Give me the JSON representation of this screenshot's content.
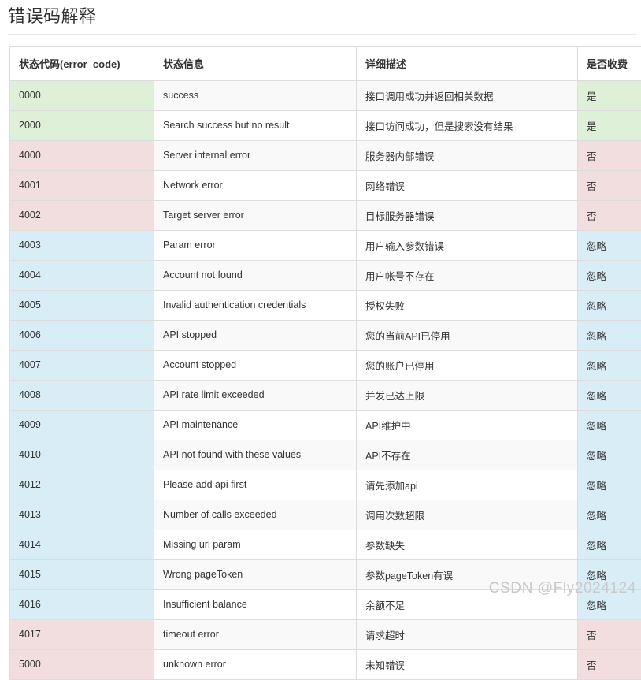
{
  "page": {
    "title": "错误码解释",
    "watermark": "CSDN @Fly2024124"
  },
  "table": {
    "columns": [
      {
        "key": "error_code",
        "label": "状态代码(error_code)"
      },
      {
        "key": "status_message",
        "label": "状态信息"
      },
      {
        "key": "description",
        "label": "详细描述"
      },
      {
        "key": "billable",
        "label": "是否收费"
      }
    ],
    "rows": [
      {
        "error_code": "0000",
        "status_message": "success",
        "description": "接口调用成功并返回相关数据",
        "billable": "是",
        "tint": "green"
      },
      {
        "error_code": "2000",
        "status_message": "Search success but no result",
        "description": "接口访问成功，但是搜索没有结果",
        "billable": "是",
        "tint": "green"
      },
      {
        "error_code": "4000",
        "status_message": "Server internal error",
        "description": "服务器内部错误",
        "billable": "否",
        "tint": "red"
      },
      {
        "error_code": "4001",
        "status_message": "Network error",
        "description": "网络错误",
        "billable": "否",
        "tint": "red"
      },
      {
        "error_code": "4002",
        "status_message": "Target server error",
        "description": "目标服务器错误",
        "billable": "否",
        "tint": "red"
      },
      {
        "error_code": "4003",
        "status_message": "Param error",
        "description": "用户输入参数错误",
        "billable": "忽略",
        "tint": "blue"
      },
      {
        "error_code": "4004",
        "status_message": "Account not found",
        "description": "用户帐号不存在",
        "billable": "忽略",
        "tint": "blue"
      },
      {
        "error_code": "4005",
        "status_message": "Invalid authentication credentials",
        "description": "授权失败",
        "billable": "忽略",
        "tint": "blue"
      },
      {
        "error_code": "4006",
        "status_message": "API stopped",
        "description": "您的当前API已停用",
        "billable": "忽略",
        "tint": "blue"
      },
      {
        "error_code": "4007",
        "status_message": "Account stopped",
        "description": "您的账户已停用",
        "billable": "忽略",
        "tint": "blue"
      },
      {
        "error_code": "4008",
        "status_message": "API rate limit exceeded",
        "description": "并发已达上限",
        "billable": "忽略",
        "tint": "blue"
      },
      {
        "error_code": "4009",
        "status_message": "API maintenance",
        "description": "API维护中",
        "billable": "忽略",
        "tint": "blue"
      },
      {
        "error_code": "4010",
        "status_message": "API not found with these values",
        "description": "API不存在",
        "billable": "忽略",
        "tint": "blue"
      },
      {
        "error_code": "4012",
        "status_message": "Please add api first",
        "description": "请先添加api",
        "billable": "忽略",
        "tint": "blue"
      },
      {
        "error_code": "4013",
        "status_message": "Number of calls exceeded",
        "description": "调用次数超限",
        "billable": "忽略",
        "tint": "blue"
      },
      {
        "error_code": "4014",
        "status_message": "Missing url param",
        "description": "参数缺失",
        "billable": "忽略",
        "tint": "blue"
      },
      {
        "error_code": "4015",
        "status_message": "Wrong pageToken",
        "description": "参数pageToken有误",
        "billable": "忽略",
        "tint": "blue"
      },
      {
        "error_code": "4016",
        "status_message": "Insufficient balance",
        "description": "余额不足",
        "billable": "忽略",
        "tint": "blue"
      },
      {
        "error_code": "4017",
        "status_message": "timeout error",
        "description": "请求超时",
        "billable": "否",
        "tint": "red"
      },
      {
        "error_code": "5000",
        "status_message": "unknown error",
        "description": "未知错误",
        "billable": "否",
        "tint": "red"
      }
    ]
  },
  "colors": {
    "tint_green": "#dff0d8",
    "tint_red": "#f2dede",
    "tint_blue": "#d9edf7",
    "stripe": "#f9f9f9",
    "border": "#dddddd"
  }
}
